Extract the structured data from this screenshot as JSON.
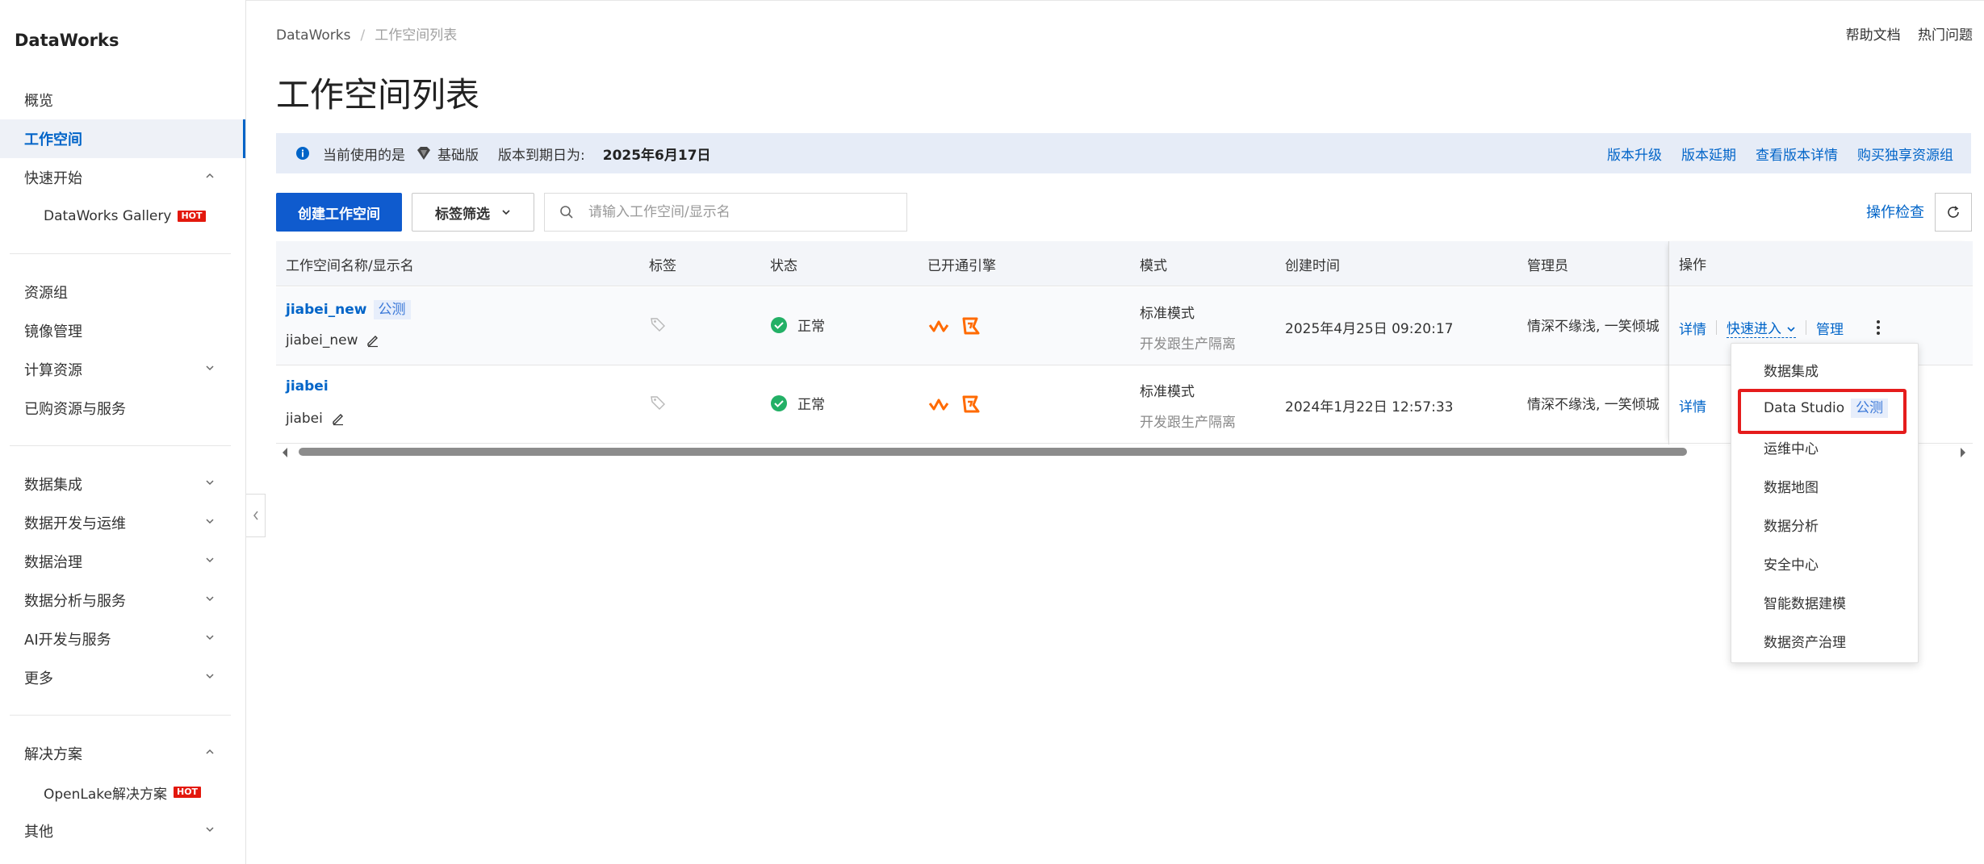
{
  "app": {
    "brand": "DataWorks"
  },
  "sidebar": {
    "items": [
      {
        "label": "概览"
      },
      {
        "label": "工作空间"
      },
      {
        "label": "快速开始"
      },
      {
        "label": "DataWorks Gallery",
        "badge": "HOT"
      },
      {
        "label": "资源组"
      },
      {
        "label": "镜像管理"
      },
      {
        "label": "计算资源"
      },
      {
        "label": "已购资源与服务"
      },
      {
        "label": "数据集成"
      },
      {
        "label": "数据开发与运维"
      },
      {
        "label": "数据治理"
      },
      {
        "label": "数据分析与服务"
      },
      {
        "label": "AI开发与服务"
      },
      {
        "label": "更多"
      },
      {
        "label": "解决方案"
      },
      {
        "label": "OpenLake解决方案",
        "badge": "HOT"
      },
      {
        "label": "其他"
      }
    ]
  },
  "breadcrumb": {
    "root": "DataWorks",
    "sep": "/",
    "current": "工作空间列表"
  },
  "top_links": {
    "help": "帮助文档",
    "faq": "热门问题"
  },
  "page_title": "工作空间列表",
  "notice": {
    "prefix": "当前使用的是",
    "edition": "基础版",
    "expire_label": "版本到期日为:",
    "expire_date": "2025年6月17日",
    "links": [
      "版本升级",
      "版本延期",
      "查看版本详情",
      "购买独享资源组"
    ],
    "accent_color": "#0064c8"
  },
  "toolbar": {
    "create_label": "创建工作空间",
    "filter_label": "标签筛选",
    "search_placeholder": "请输入工作空间/显示名",
    "op_check_label": "操作检查"
  },
  "table": {
    "columns": [
      "工作空间名称/显示名",
      "标签",
      "状态",
      "已开通引擎",
      "模式",
      "创建时间",
      "管理员",
      "操作"
    ],
    "rows": [
      {
        "name": "jiabei_new",
        "badge": "公测",
        "display_name": "jiabei_new",
        "status": "正常",
        "mode": "标准模式",
        "mode_sub": "开发跟生产隔离",
        "created": "2025年4月25日 09:20:17",
        "admin": "情深不缘浅, 一笑倾城",
        "ops": {
          "detail": "详情",
          "quick": "快速进入",
          "manage": "管理"
        }
      },
      {
        "name": "jiabei",
        "badge": "",
        "display_name": "jiabei",
        "status": "正常",
        "mode": "标准模式",
        "mode_sub": "开发跟生产隔离",
        "created": "2024年1月22日 12:57:33",
        "admin": "情深不缘浅, 一笑倾城",
        "ops": {
          "detail": "详情"
        }
      }
    ]
  },
  "dropdown": {
    "items": [
      "数据集成",
      "Data Studio",
      "运维中心",
      "数据地图",
      "数据分析",
      "安全中心",
      "智能数据建模",
      "数据资产治理"
    ],
    "data_studio_badge": "公测",
    "highlight_color": "#e51c1c"
  }
}
